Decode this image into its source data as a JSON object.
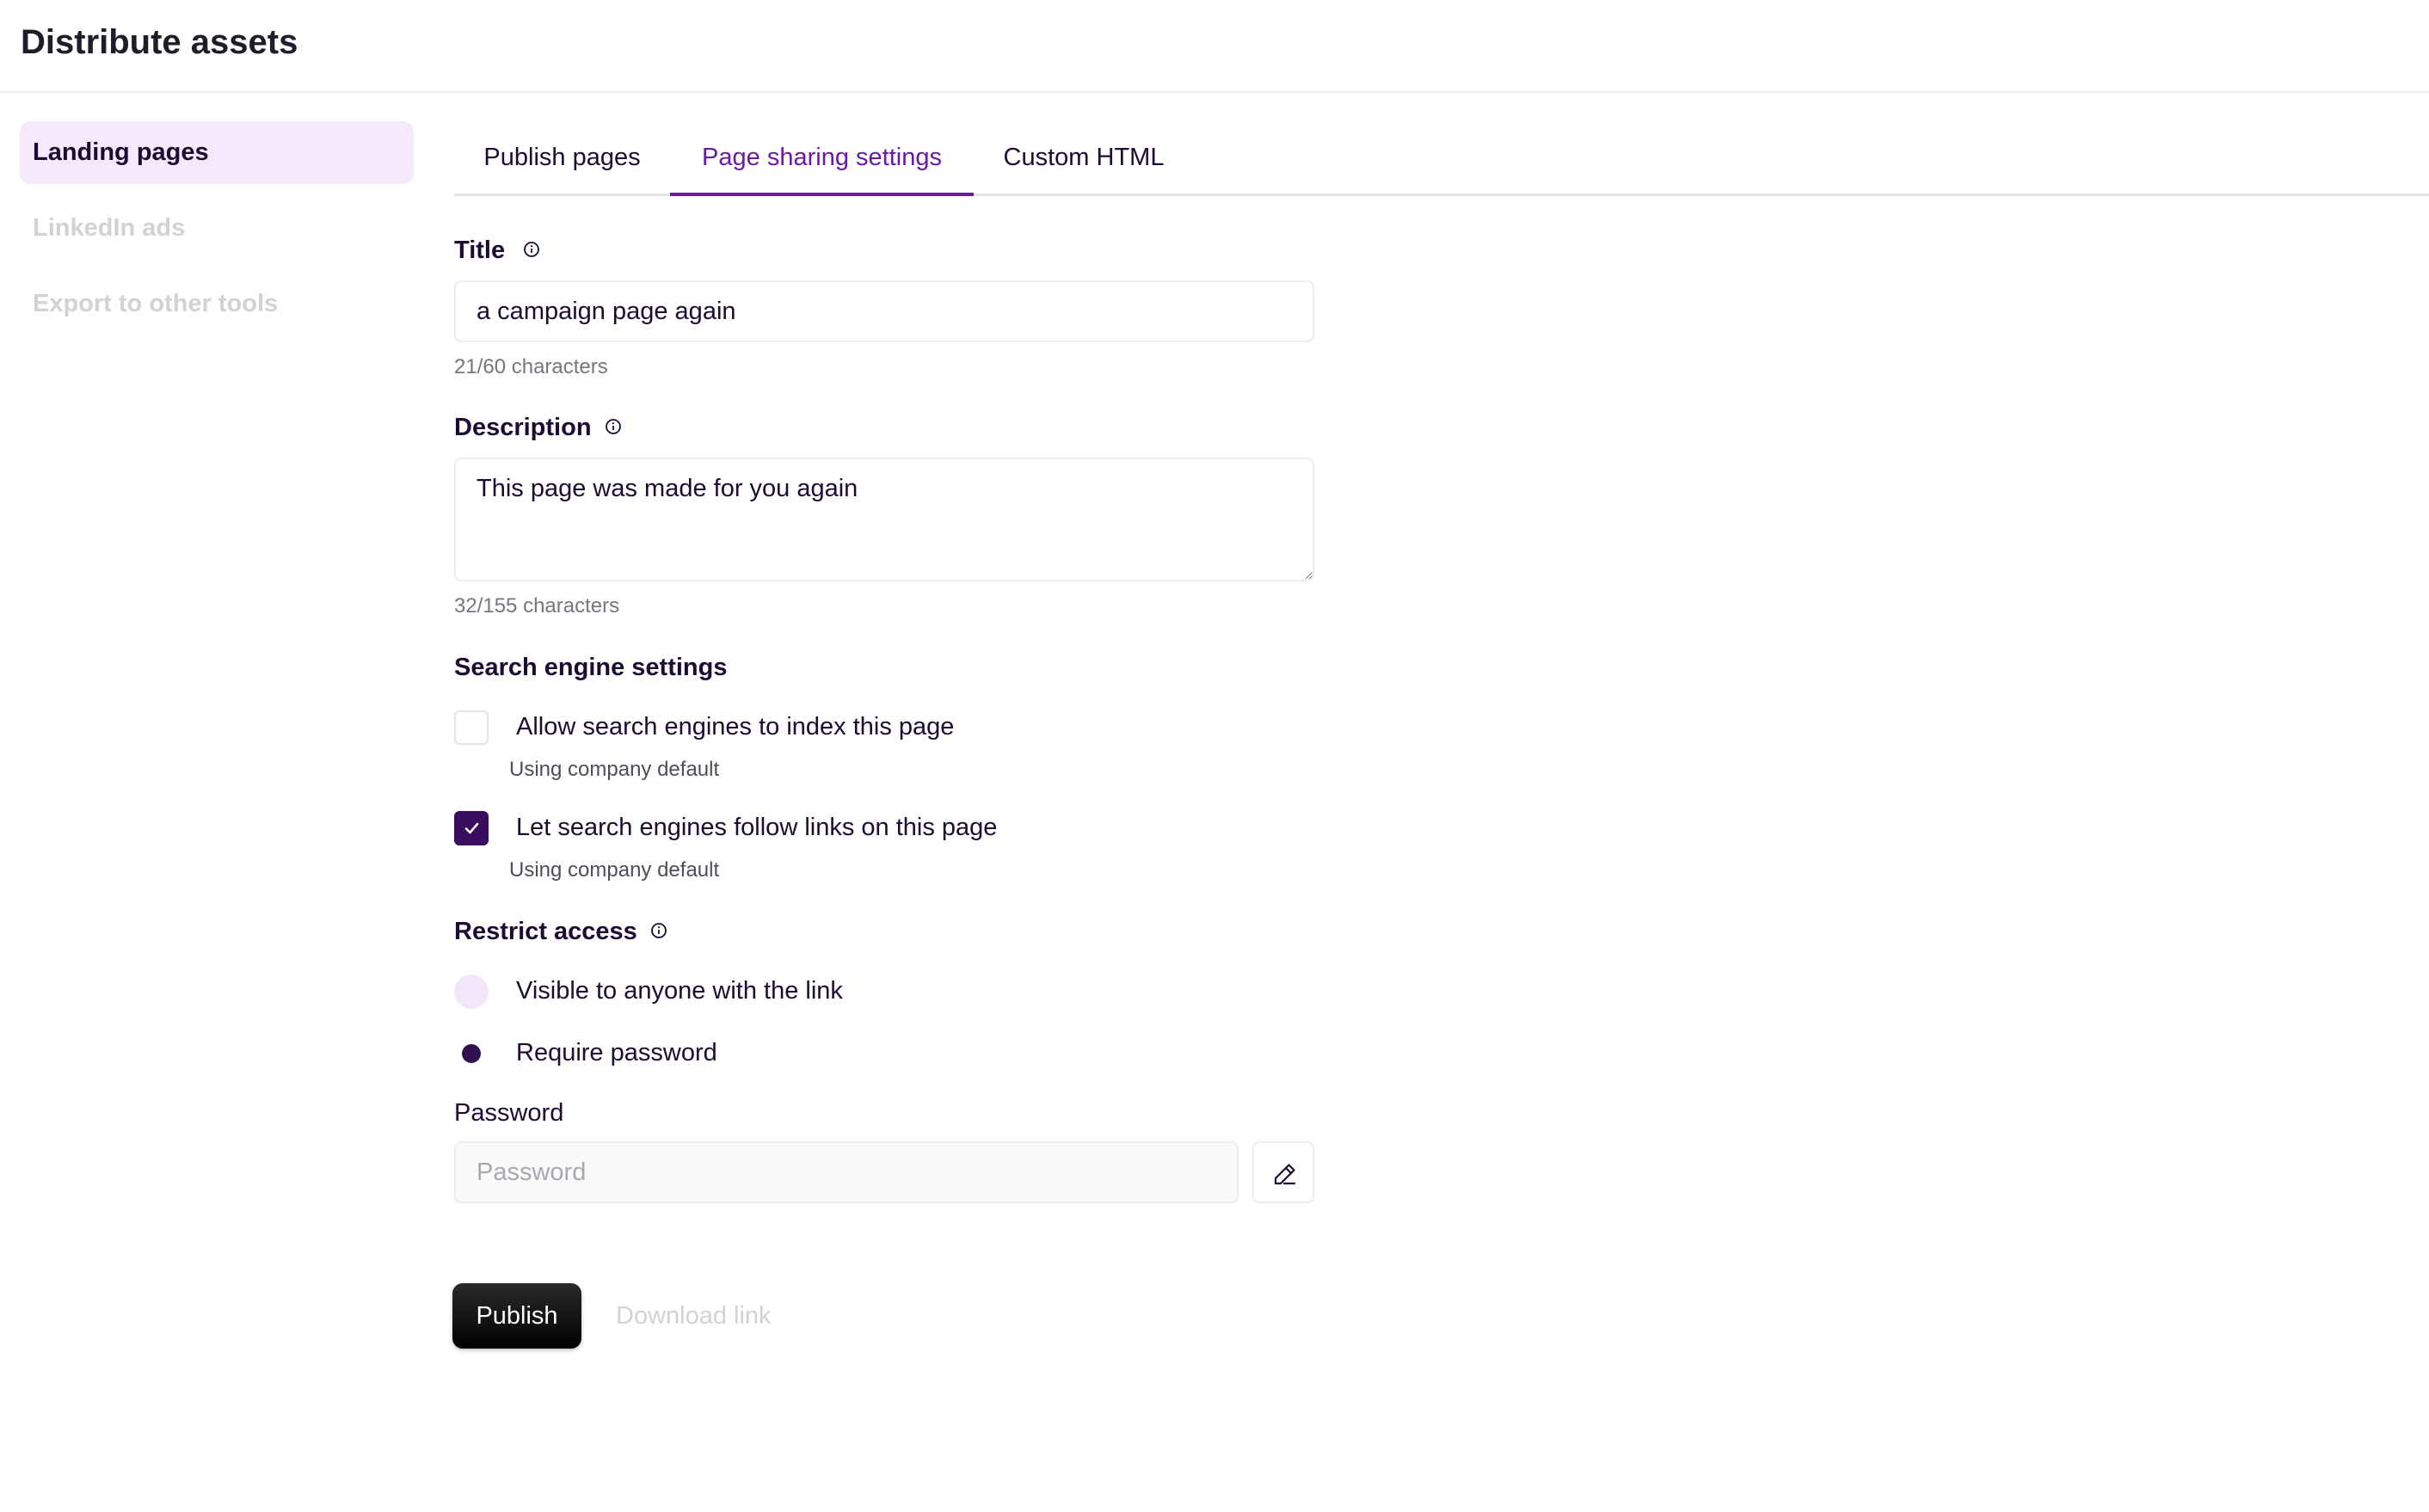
{
  "page_title": "Distribute assets",
  "sidebar": {
    "items": [
      {
        "label": "Landing pages",
        "active": true
      },
      {
        "label": "LinkedIn ads",
        "active": false
      },
      {
        "label": "Export to other tools",
        "active": false
      }
    ]
  },
  "tabs": [
    {
      "label": "Publish pages",
      "active": false
    },
    {
      "label": "Page sharing settings",
      "active": true
    },
    {
      "label": "Custom HTML",
      "active": false
    }
  ],
  "form": {
    "title": {
      "label": "Title",
      "value": "a campaign page again",
      "count": "21/60 characters"
    },
    "description": {
      "label": "Description",
      "value": "This page was made for you again",
      "count": "32/155 characters"
    },
    "search_engine": {
      "heading": "Search engine settings",
      "options": [
        {
          "label": "Allow search engines to index this page",
          "hint": "Using company default",
          "checked": false
        },
        {
          "label": "Let search engines follow links on this page",
          "hint": "Using company default",
          "checked": true
        }
      ]
    },
    "restrict_access": {
      "heading": "Restrict access",
      "options": [
        {
          "label": "Visible to anyone with the link",
          "selected": false
        },
        {
          "label": "Require password",
          "selected": true
        }
      ]
    },
    "password": {
      "label": "Password",
      "placeholder": "Password",
      "value": ""
    }
  },
  "actions": {
    "publish_label": "Publish",
    "download_label": "Download link"
  },
  "icons": {
    "info": "info-icon",
    "check": "check-icon",
    "edit": "pencil-icon"
  },
  "colors": {
    "accent": "#6a1aa3",
    "dark_purple": "#3a0d5e",
    "sidebar_active_bg": "#f5e9fc",
    "publish_bg": "#000000"
  }
}
